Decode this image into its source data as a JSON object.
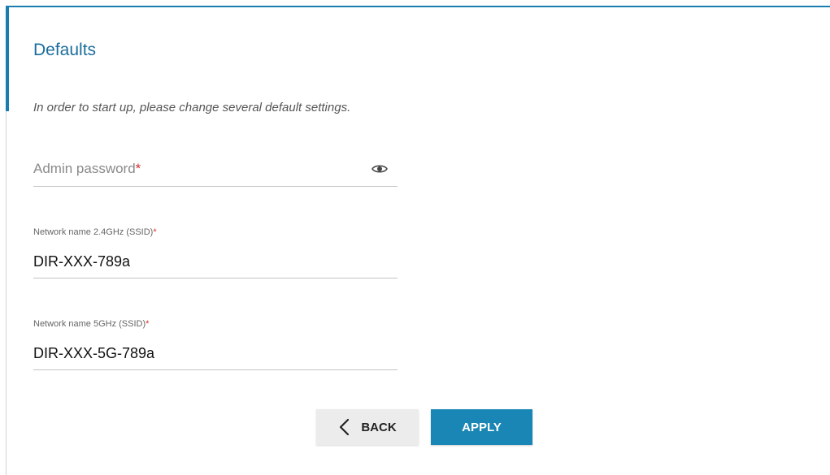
{
  "header": {
    "title": "Defaults",
    "accent_color": "#1a7db0"
  },
  "intro": {
    "text": "In order to start up, please change several default settings."
  },
  "form": {
    "admin_password": {
      "placeholder": "Admin password",
      "required_mark": "*",
      "value": "",
      "toggle_icon": "eye-icon"
    },
    "ssid_24": {
      "label": "Network name 2.4GHz (SSID)",
      "required_mark": "*",
      "value": "DIR-XXX-789a"
    },
    "ssid_5": {
      "label": "Network name 5GHz (SSID)",
      "required_mark": "*",
      "value": "DIR-XXX-5G-789a"
    }
  },
  "actions": {
    "back_label": "BACK",
    "back_icon": "chevron-left-icon",
    "apply_label": "APPLY",
    "apply_color": "#1a86b5"
  }
}
